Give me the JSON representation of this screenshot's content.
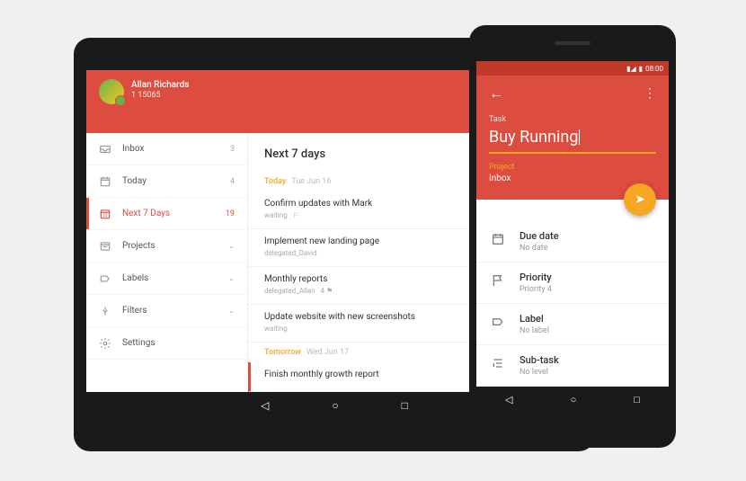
{
  "tablet": {
    "user": {
      "name": "Allan Richards",
      "count": "1 15065"
    },
    "sidebar": [
      {
        "icon": "inbox",
        "label": "Inbox",
        "count": "3"
      },
      {
        "icon": "calendar",
        "label": "Today",
        "count": "4"
      },
      {
        "icon": "calendar-days",
        "label": "Next 7 Days",
        "count": "19",
        "active": true
      },
      {
        "icon": "projects",
        "label": "Projects",
        "chevron": true
      },
      {
        "icon": "label",
        "label": "Labels",
        "chevron": true
      },
      {
        "icon": "filter",
        "label": "Filters",
        "chevron": true
      },
      {
        "icon": "gear",
        "label": "Settings"
      }
    ],
    "main_title": "Next 7 days",
    "sections": [
      {
        "label": "Today",
        "date": "Tue Jun 16",
        "tasks": [
          {
            "title": "Confirm updates with Mark",
            "meta": "waiting",
            "flag": true
          },
          {
            "title": "Implement new landing page",
            "meta": "delegated_David"
          },
          {
            "title": "Monthly reports",
            "meta": "delegated_Allan",
            "extra": "4  ⚑"
          },
          {
            "title": "Update website with new screenshots",
            "meta": "waiting"
          }
        ]
      },
      {
        "label": "Tomorrow",
        "date": "Wed Jun 17",
        "tasks": [
          {
            "title": "Finish monthly growth report",
            "bar": true
          }
        ]
      }
    ]
  },
  "phone": {
    "status_time": "08:00",
    "task_label": "Task",
    "task_title": "Buy Running",
    "project_label": "Project",
    "project_value": "Inbox",
    "details": [
      {
        "icon": "calendar",
        "label": "Due date",
        "value": "No date"
      },
      {
        "icon": "flag",
        "label": "Priority",
        "value": "Priority 4"
      },
      {
        "icon": "label",
        "label": "Label",
        "value": "No label"
      },
      {
        "icon": "subtask",
        "label": "Sub-task",
        "value": "No level"
      }
    ]
  }
}
